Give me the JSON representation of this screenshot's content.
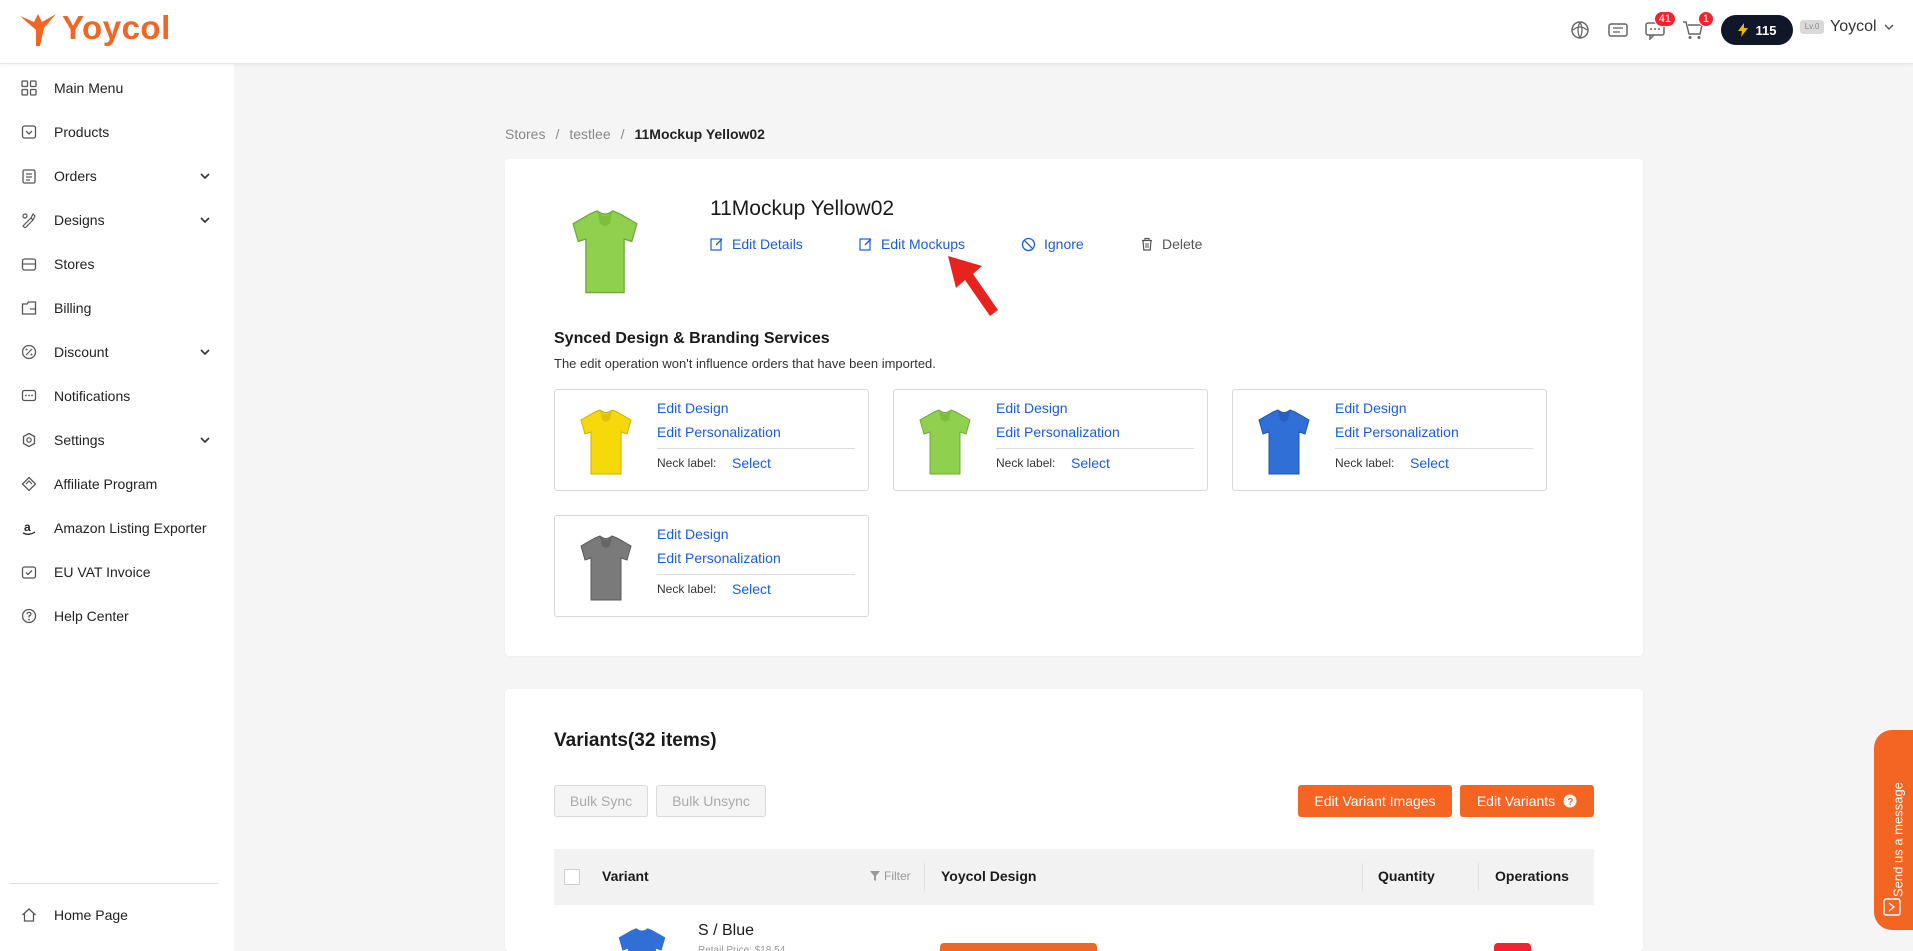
{
  "header": {
    "logo_text": "Yoycol",
    "messages_badge": "41",
    "cart_badge": "1",
    "credits": "115",
    "user_name": "Yoycol",
    "user_level": "Lv.0",
    "icons": [
      "globe-icon",
      "ticket-icon",
      "message-icon",
      "cart-icon"
    ]
  },
  "sidebar": {
    "items": [
      {
        "label": "Main Menu",
        "icon": "grid-icon"
      },
      {
        "label": "Products",
        "icon": "product-icon"
      },
      {
        "label": "Orders",
        "icon": "orders-icon"
      },
      {
        "label": "Designs",
        "icon": "designs-icon"
      },
      {
        "label": "Stores",
        "icon": "store-icon"
      },
      {
        "label": "Billing",
        "icon": "billing-icon"
      },
      {
        "label": "Discount",
        "icon": "discount-icon"
      },
      {
        "label": "Notifications",
        "icon": "notification-icon"
      },
      {
        "label": "Settings",
        "icon": "settings-icon"
      },
      {
        "label": "Affiliate Program",
        "icon": "affiliate-icon"
      },
      {
        "label": "Amazon Listing Exporter",
        "icon": "amazon-icon"
      },
      {
        "label": "EU VAT Invoice",
        "icon": "invoice-icon"
      },
      {
        "label": "Help Center",
        "icon": "help-icon"
      }
    ],
    "home": "Home Page"
  },
  "breadcrumb": {
    "items": [
      "Stores",
      "testlee",
      "11Mockup Yellow02"
    ],
    "sep": "/"
  },
  "product": {
    "title": "11Mockup Yellow02",
    "actions": {
      "edit_details": "Edit Details",
      "edit_mockups": "Edit Mockups",
      "ignore": "Ignore",
      "delete": "Delete"
    }
  },
  "synced": {
    "title": "Synced Design & Branding Services",
    "subtitle": "The edit operation won't influence orders that have been imported.",
    "cards": [
      {
        "color": "#f5d90a",
        "edit_design": "Edit Design",
        "edit_personalization": "Edit Personalization",
        "neck_label": "Neck label:",
        "select": "Select"
      },
      {
        "color": "#8fd14f",
        "edit_design": "Edit Design",
        "edit_personalization": "Edit Personalization",
        "neck_label": "Neck label:",
        "select": "Select"
      },
      {
        "color": "#2f6fd6",
        "edit_design": "Edit Design",
        "edit_personalization": "Edit Personalization",
        "neck_label": "Neck label:",
        "select": "Select"
      },
      {
        "color": "#7a7a7a",
        "edit_design": "Edit Design",
        "edit_personalization": "Edit Personalization",
        "neck_label": "Neck label:",
        "select": "Select"
      }
    ]
  },
  "variants": {
    "title": "Variants(32 items)",
    "bulk_sync": "Bulk Sync",
    "bulk_unsync": "Bulk Unsync",
    "edit_variant_images": "Edit Variant Images",
    "edit_variants": "Edit Variants",
    "columns": {
      "variant": "Variant",
      "filter": "Filter",
      "design": "Yoycol Design",
      "quantity": "Quantity",
      "operations": "Operations"
    },
    "first_row": {
      "name": "S / Blue",
      "price": "Retail Price: $18.54"
    }
  },
  "chat": {
    "label": "Send us a message"
  },
  "colors": {
    "accent": "#f26522",
    "link": "#1a5cd8",
    "product_green": "#8fd14f"
  }
}
